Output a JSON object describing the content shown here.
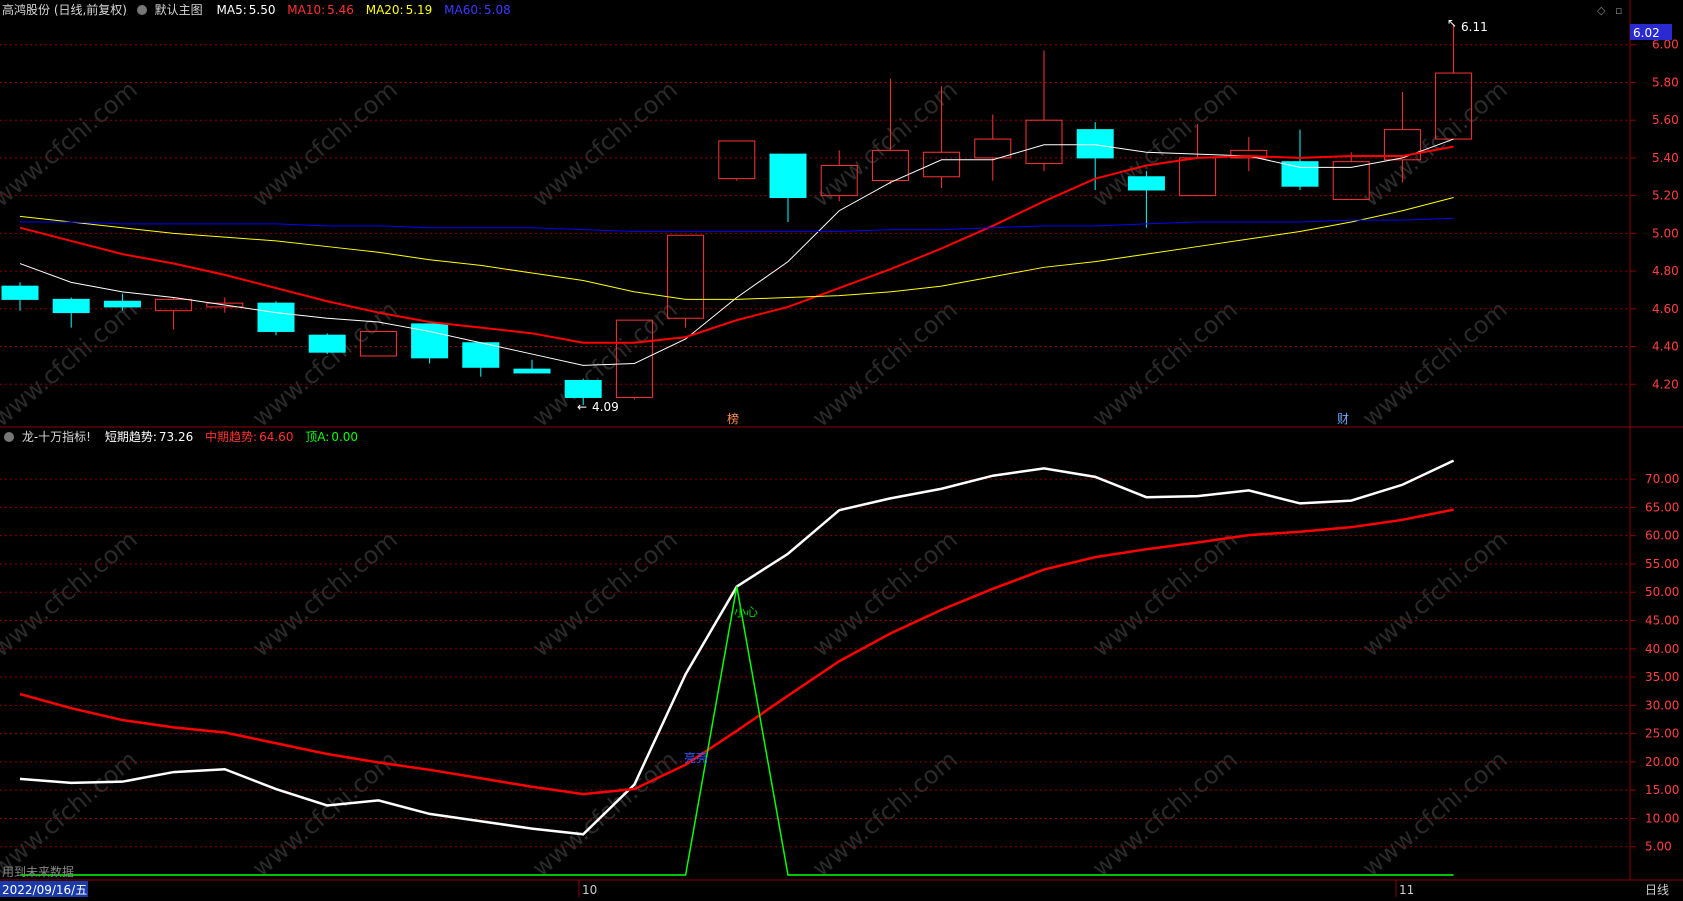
{
  "header": {
    "stock": "高鸿股份 (日线,前复权)",
    "main_chart": "默认主图",
    "ma5_label": "MA5:",
    "ma5_value": "5.50",
    "ma10_label": "MA10:",
    "ma10_value": "5.46",
    "ma20_label": "MA20:",
    "ma20_value": "5.19",
    "ma60_label": "MA60:",
    "ma60_value": "5.08"
  },
  "indicator_header": {
    "name": "龙-十万指标!",
    "short_label": "短期趋势:",
    "short_value": "73.26",
    "mid_label": "中期趋势:",
    "mid_value": "64.60",
    "top_label": "顶A:",
    "top_value": "0.00"
  },
  "price_badge": "6.02",
  "bottom_bar": {
    "date": "2022/09/16/五",
    "month_oct": "10",
    "month_nov": "11",
    "period": "日线",
    "future_data": "用到未来数据"
  },
  "markers": {
    "bang": "榜",
    "cai": "财",
    "xiaoxin": "小心",
    "gaoliang": "亮亮",
    "low_label": "4.09",
    "high_label": "6.11"
  },
  "watermark": "www.cfchi.com",
  "colors": {
    "background": "#000000",
    "up_candle": "#ff3232",
    "down_candle": "#00ffff",
    "ma5": "#ffffff",
    "ma10": "#ff0000",
    "ma20": "#ffff00",
    "ma60": "#0000ff",
    "short_trend": "#ffffff",
    "mid_trend": "#ff0000",
    "top_a": "#00ff00",
    "grid": "#8b0000"
  },
  "chart_data": [
    {
      "type": "candlestick",
      "title": "高鸿股份 (日线,前复权)",
      "ylim": [
        4.0,
        8.1
      ],
      "y_ticks": [
        "4.20",
        "4.40",
        "4.60",
        "4.80",
        "5.00",
        "5.20",
        "5.40",
        "5.60",
        "5.80",
        "6.00"
      ],
      "candles": [
        {
          "o": 4.72,
          "h": 4.74,
          "l": 4.59,
          "c": 4.65
        },
        {
          "o": 4.65,
          "h": 4.66,
          "l": 4.5,
          "c": 4.58
        },
        {
          "o": 4.64,
          "h": 4.68,
          "l": 4.59,
          "c": 4.61
        },
        {
          "o": 4.59,
          "h": 4.66,
          "l": 4.49,
          "c": 4.65
        },
        {
          "o": 4.61,
          "h": 4.66,
          "l": 4.58,
          "c": 4.63
        },
        {
          "o": 4.63,
          "h": 4.64,
          "l": 4.46,
          "c": 4.48
        },
        {
          "o": 4.46,
          "h": 4.47,
          "l": 4.36,
          "c": 4.37
        },
        {
          "o": 4.35,
          "h": 4.48,
          "l": 4.35,
          "c": 4.48
        },
        {
          "o": 4.52,
          "h": 4.52,
          "l": 4.31,
          "c": 4.34
        },
        {
          "o": 4.42,
          "h": 4.42,
          "l": 4.24,
          "c": 4.29
        },
        {
          "o": 4.28,
          "h": 4.33,
          "l": 4.26,
          "c": 4.26
        },
        {
          "o": 4.22,
          "h": 4.23,
          "l": 4.09,
          "c": 4.13
        },
        {
          "o": 4.13,
          "h": 4.54,
          "l": 4.12,
          "c": 4.54
        },
        {
          "o": 4.55,
          "h": 4.99,
          "l": 4.5,
          "c": 4.99
        },
        {
          "o": 5.29,
          "h": 5.49,
          "l": 5.28,
          "c": 5.49
        },
        {
          "o": 5.42,
          "h": 5.42,
          "l": 5.06,
          "c": 5.19
        },
        {
          "o": 5.2,
          "h": 5.44,
          "l": 5.17,
          "c": 5.36
        },
        {
          "o": 5.28,
          "h": 5.82,
          "l": 5.26,
          "c": 5.44
        },
        {
          "o": 5.3,
          "h": 5.78,
          "l": 5.24,
          "c": 5.43
        },
        {
          "o": 5.4,
          "h": 5.63,
          "l": 5.28,
          "c": 5.5
        },
        {
          "o": 5.37,
          "h": 5.97,
          "l": 5.33,
          "c": 5.6
        },
        {
          "o": 5.55,
          "h": 5.59,
          "l": 5.23,
          "c": 5.4
        },
        {
          "o": 5.3,
          "h": 5.33,
          "l": 5.03,
          "c": 5.23
        },
        {
          "o": 5.2,
          "h": 5.58,
          "l": 5.2,
          "c": 5.4
        },
        {
          "o": 5.4,
          "h": 5.51,
          "l": 5.33,
          "c": 5.44
        },
        {
          "o": 5.38,
          "h": 5.55,
          "l": 5.23,
          "c": 5.25
        },
        {
          "o": 5.18,
          "h": 5.43,
          "l": 5.18,
          "c": 5.38
        },
        {
          "o": 5.39,
          "h": 5.75,
          "l": 5.27,
          "c": 5.55
        },
        {
          "o": 5.5,
          "h": 6.11,
          "l": 5.5,
          "c": 5.85
        }
      ],
      "series": [
        {
          "name": "MA5",
          "values": [
            4.84,
            4.74,
            4.69,
            4.66,
            4.62,
            4.58,
            4.55,
            4.53,
            4.48,
            4.42,
            4.36,
            4.3,
            4.31,
            4.44,
            4.66,
            4.85,
            5.12,
            5.27,
            5.39,
            5.39,
            5.47,
            5.47,
            5.43,
            5.42,
            5.41,
            5.35,
            5.35,
            5.4,
            5.5
          ]
        },
        {
          "name": "MA10",
          "values": [
            5.03,
            4.96,
            4.89,
            4.84,
            4.78,
            4.71,
            4.64,
            4.58,
            4.53,
            4.5,
            4.47,
            4.42,
            4.42,
            4.45,
            4.54,
            4.61,
            4.71,
            4.81,
            4.92,
            5.04,
            5.17,
            5.29,
            5.36,
            5.4,
            5.41,
            5.4,
            5.41,
            5.41,
            5.46
          ]
        },
        {
          "name": "MA20",
          "values": [
            5.09,
            5.06,
            5.03,
            5.0,
            4.98,
            4.96,
            4.93,
            4.9,
            4.86,
            4.83,
            4.79,
            4.75,
            4.69,
            4.65,
            4.65,
            4.66,
            4.67,
            4.69,
            4.72,
            4.77,
            4.82,
            4.85,
            4.89,
            4.93,
            4.97,
            5.01,
            5.06,
            5.12,
            5.19
          ]
        },
        {
          "name": "MA60",
          "values": [
            5.06,
            5.06,
            5.05,
            5.05,
            5.05,
            5.05,
            5.04,
            5.04,
            5.03,
            5.03,
            5.03,
            5.02,
            5.01,
            5.01,
            5.01,
            5.01,
            5.01,
            5.02,
            5.02,
            5.03,
            5.04,
            5.04,
            5.05,
            5.06,
            5.06,
            5.06,
            5.07,
            5.07,
            5.08
          ]
        }
      ]
    },
    {
      "type": "line",
      "title": "龙-十万指标!",
      "ylim": [
        0,
        76
      ],
      "y_ticks": [
        "5.00",
        "10.00",
        "15.00",
        "20.00",
        "25.00",
        "30.00",
        "35.00",
        "40.00",
        "45.00",
        "50.00",
        "55.00",
        "60.00",
        "65.00",
        "70.00"
      ],
      "series": [
        {
          "name": "短期趋势",
          "values": [
            17.0,
            16.3,
            16.5,
            18.2,
            18.7,
            15.2,
            12.3,
            13.2,
            10.8,
            9.5,
            8.2,
            7.2,
            16.0,
            35.5,
            51.0,
            56.8,
            64.5,
            66.6,
            68.3,
            70.6,
            71.9,
            70.4,
            66.8,
            67.0,
            68.0,
            65.7,
            66.2,
            69.0,
            73.26
          ]
        },
        {
          "name": "中期趋势",
          "values": [
            32.0,
            29.5,
            27.4,
            26.1,
            25.2,
            23.3,
            21.4,
            19.9,
            18.6,
            17.1,
            15.6,
            14.3,
            15.2,
            19.5,
            25.5,
            31.7,
            37.8,
            42.7,
            46.9,
            50.6,
            54.0,
            56.2,
            57.6,
            58.8,
            60.1,
            60.7,
            61.5,
            62.8,
            64.6
          ]
        },
        {
          "name": "顶A",
          "values": [
            0,
            0,
            0,
            0,
            0,
            0,
            0,
            0,
            0,
            0,
            0,
            0,
            0,
            0,
            51.0,
            0,
            0,
            0,
            0,
            0,
            0,
            0,
            0,
            0,
            0,
            0,
            0,
            0,
            0
          ]
        }
      ]
    }
  ]
}
